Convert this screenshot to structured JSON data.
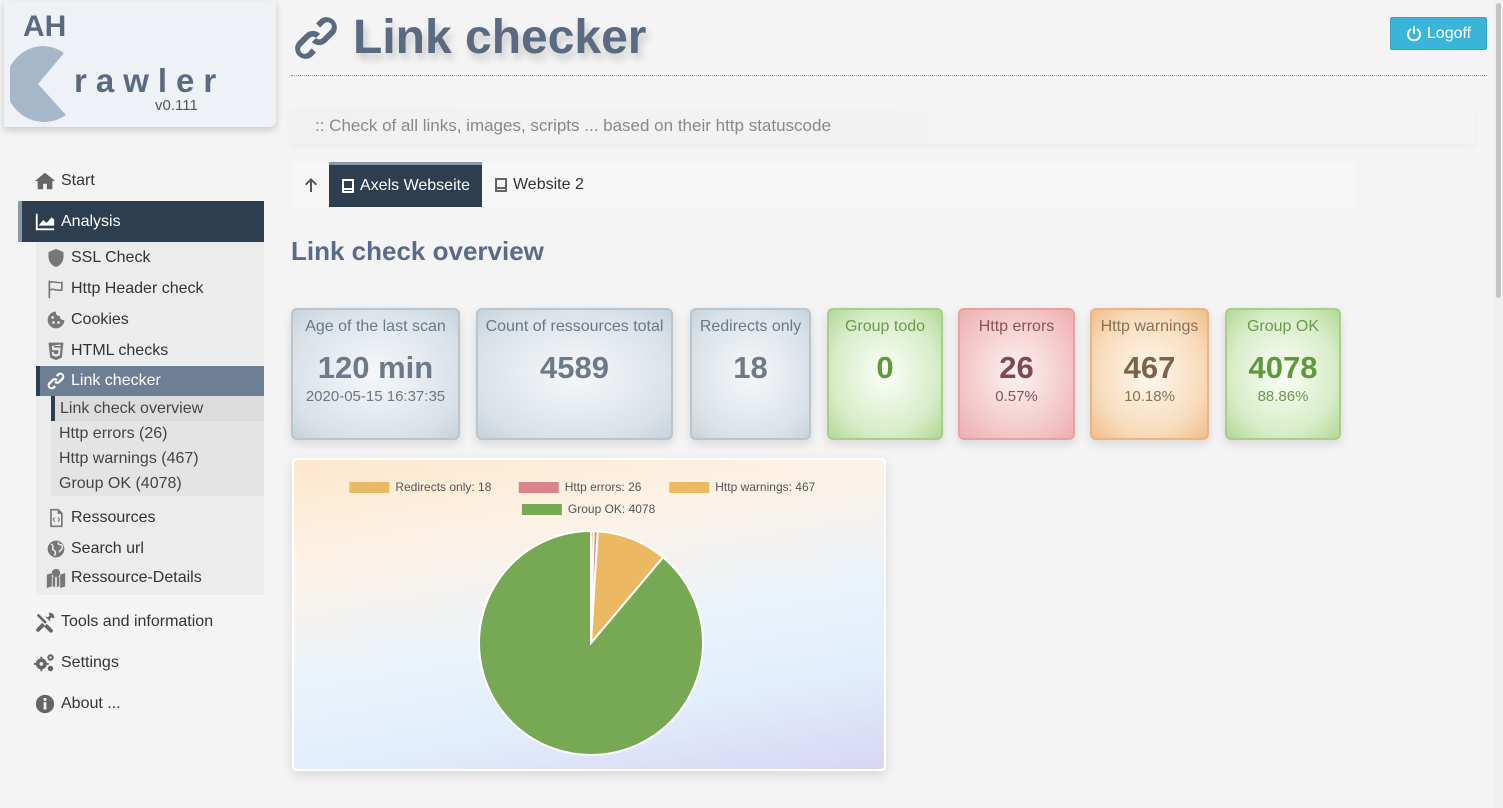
{
  "logo": {
    "brand_top": "AH",
    "brand_rest": "rawler",
    "version": "v0.111"
  },
  "header": {
    "title": "Link checker",
    "subtitle": ":: Check of all links, images, scripts ... based on their http statuscode",
    "logoff_label": "Logoff"
  },
  "sidebar": {
    "start": "Start",
    "analysis": "Analysis",
    "analysis_items": [
      {
        "label": "SSL Check",
        "icon": "shield-icon"
      },
      {
        "label": "Http Header check",
        "icon": "flag-icon"
      },
      {
        "label": "Cookies",
        "icon": "cookie-icon"
      },
      {
        "label": "HTML checks",
        "icon": "html5-icon"
      },
      {
        "label": "Link checker",
        "icon": "link-icon"
      }
    ],
    "link_checker_items": [
      "Link check overview",
      "Http errors (26)",
      "Http warnings (467)",
      "Group OK (4078)"
    ],
    "more_items": [
      {
        "label": "Ressources",
        "icon": "file-code-icon"
      },
      {
        "label": "Search url",
        "icon": "globe-icon"
      },
      {
        "label": "Ressource-Details",
        "icon": "map-marker-icon"
      }
    ],
    "bottom_items": [
      {
        "label": "Tools and information",
        "icon": "tools-icon"
      },
      {
        "label": "Settings",
        "icon": "cogs-icon"
      },
      {
        "label": "About ...",
        "icon": "info-icon"
      }
    ]
  },
  "tabs": [
    {
      "label": "Axels Webseite",
      "active": true
    },
    {
      "label": "Website 2",
      "active": false
    }
  ],
  "main": {
    "section_title": "Link check overview",
    "tiles": [
      {
        "label": "Age of the last scan",
        "value": "120 min",
        "sub": "2020-05-15 16:37:35",
        "style": "gray"
      },
      {
        "label": "Count of ressources total",
        "value": "4589",
        "sub": "",
        "style": "gray"
      },
      {
        "label": "Redirects only",
        "value": "18",
        "sub": "",
        "style": "gray"
      },
      {
        "label": "Group todo",
        "value": "0",
        "sub": "",
        "style": "green"
      },
      {
        "label": "Http errors",
        "value": "26",
        "sub": "0.57%",
        "style": "red"
      },
      {
        "label": "Http warnings",
        "value": "467",
        "sub": "10.18%",
        "style": "orange"
      },
      {
        "label": "Group OK",
        "value": "4078",
        "sub": "88.86%",
        "style": "green"
      }
    ]
  },
  "chart_data": {
    "type": "pie",
    "title": "",
    "legend_position": "top",
    "categories": [
      "Redirects only",
      "Http errors",
      "Http warnings",
      "Group OK"
    ],
    "values": [
      18,
      26,
      467,
      4078
    ],
    "legend_labels": [
      "Redirects only: 18",
      "Http errors: 26",
      "Http warnings: 467",
      "Group OK: 4078"
    ],
    "colors": [
      "#e9b963",
      "#da8388",
      "#ecb861",
      "#77a853"
    ]
  }
}
